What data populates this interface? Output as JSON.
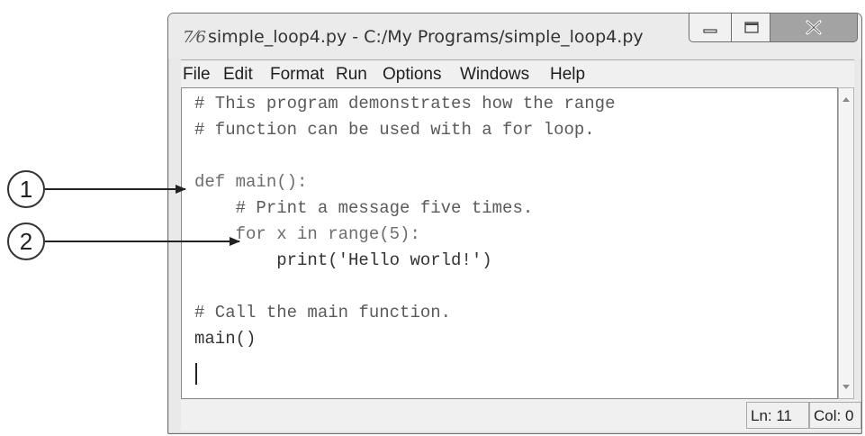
{
  "window": {
    "icon_text": "7⁄6",
    "title": "simple_loop4.py - C:/My Programs/simple_loop4.py"
  },
  "controls": {
    "minimize": "minimize",
    "maximize": "maximize",
    "close": "close"
  },
  "menu": [
    "File",
    "Edit",
    "Format",
    "Run",
    "Options",
    "Windows",
    "Help"
  ],
  "code": [
    "# This program demonstrates how the range",
    "# function can be used with a for loop.",
    "",
    "def main():",
    "    # Print a message five times.",
    "    for x in range(5):",
    "        print('Hello world!')",
    "",
    "# Call the main function.",
    "main()"
  ],
  "status": {
    "line": "Ln: 11",
    "col": "Col: 0"
  },
  "callouts": [
    "1",
    "2"
  ],
  "colors": {
    "frame": "#6f6f6f",
    "menu_bg": "#f0f0f0",
    "editor_bg": "#ffffff",
    "text": "#555555"
  }
}
